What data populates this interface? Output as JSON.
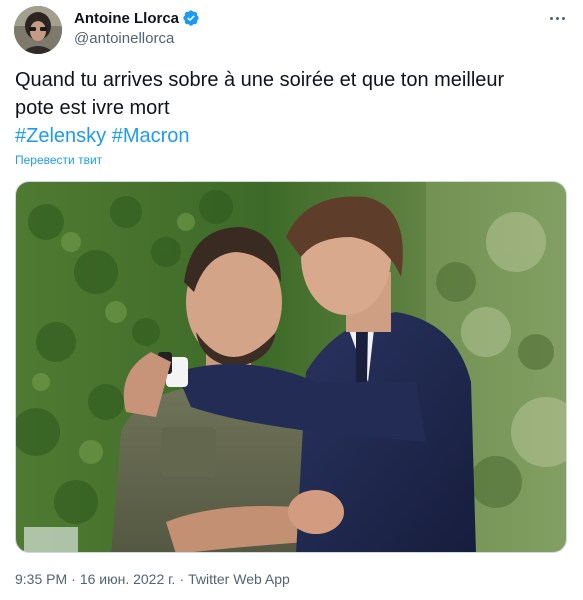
{
  "author": {
    "display_name": "Antoine Llorca",
    "handle": "@antoinellorca",
    "verified": true,
    "avatar_icon": "avatar-photo"
  },
  "tweet": {
    "text_line1": "Quand tu arrives sobre à une soirée et que ton meilleur",
    "text_line2": "pote est ivre mort",
    "hashtag1": "#Zelensky",
    "hashtag2": "#Macron",
    "translate_label": "Перевести твит"
  },
  "meta": {
    "time": "9:35 PM",
    "date": "16 июн. 2022 г.",
    "separator": "·",
    "source": "Twitter Web App"
  },
  "colors": {
    "link": "#1d9bf0",
    "secondary_text": "#536471",
    "primary_text": "#0f1419",
    "verified_badge": "#1d9bf0"
  },
  "icons": {
    "more": "more-dots-icon",
    "verified": "verified-badge-icon"
  }
}
